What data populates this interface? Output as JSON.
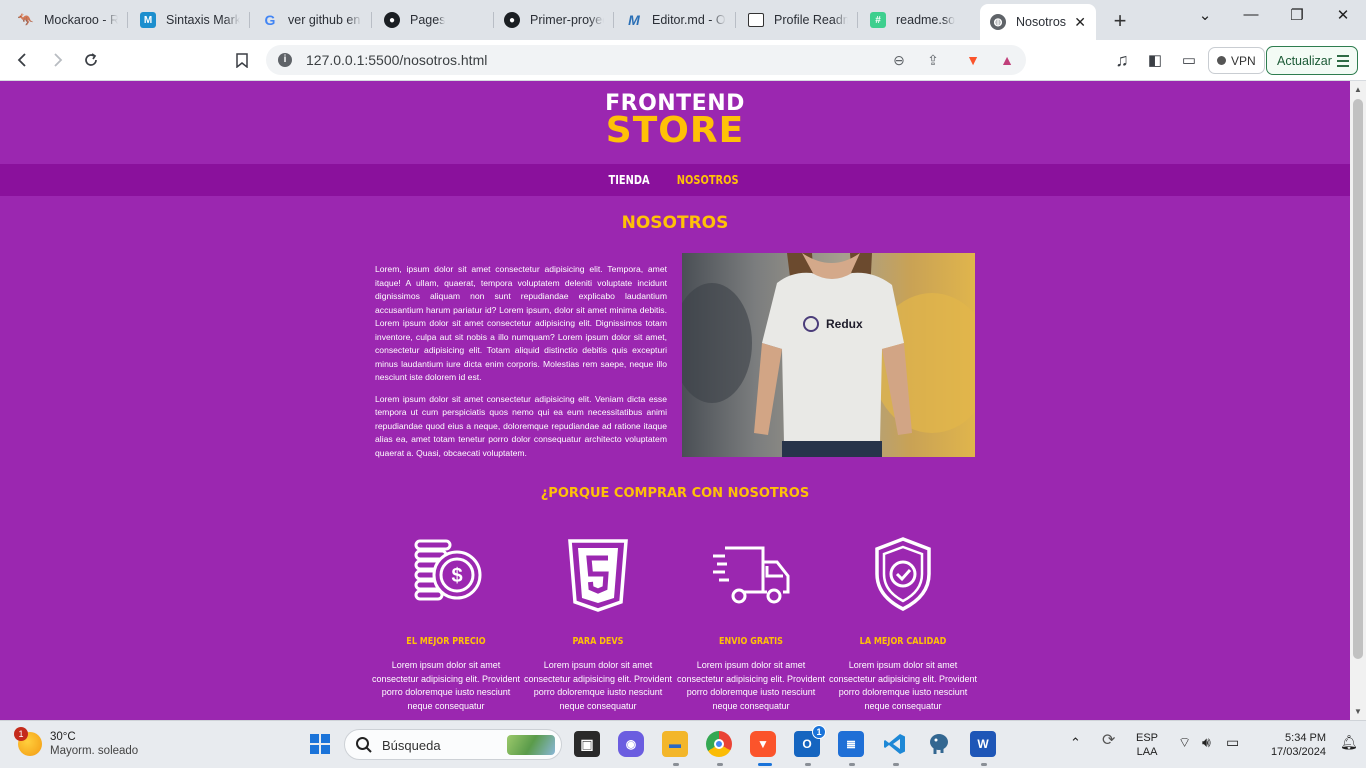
{
  "browser": {
    "tabs": [
      {
        "title": "Mockaroo - Ra",
        "icon": "mockaroo-icon"
      },
      {
        "title": "Sintaxis Markd",
        "icon": "markdown-icon"
      },
      {
        "title": "ver github en c",
        "icon": "google-icon"
      },
      {
        "title": "Pages",
        "icon": "github-icon"
      },
      {
        "title": "Primer-proyec",
        "icon": "github-icon"
      },
      {
        "title": "Editor.md - Op",
        "icon": "editormd-icon"
      },
      {
        "title": "Profile Readm",
        "icon": "document-icon"
      },
      {
        "title": "readme.so",
        "icon": "readme-icon"
      },
      {
        "title": "Nosotros",
        "icon": "globe-icon",
        "active": true
      }
    ],
    "url": "127.0.0.1:5500/nosotros.html",
    "vpn_label": "VPN",
    "update_label": "Actualizar"
  },
  "page": {
    "logo_line1": "FRONTEND",
    "logo_line2": "STORE",
    "nav": {
      "shop": "TIENDA",
      "about": "NOSOTROS"
    },
    "about_title": "NOSOTROS",
    "about_paragraphs": [
      "Lorem, ipsum dolor sit amet consectetur adipisicing elit. Tempora, amet itaque! A ullam, quaerat, tempora voluptatem deleniti voluptate incidunt dignissimos aliquam non sunt repudiandae explicabo laudantium accusantium harum pariatur id? Lorem ipsum, dolor sit amet minima debitis. Lorem ipsum dolor sit amet consectetur adipisicing elit. Dignissimos totam inventore, culpa aut sit nobis a illo numquam? Lorem ipsum dolor sit amet, consectetur adipisicing elit. Totam aliquid distinctio debitis quis excepturi minus laudantium iure dicta enim corporis. Molestias rem saepe, neque illo nesciunt iste dolorem id est.",
      "Lorem ipsum dolor sit amet consectetur adipisicing elit. Veniam dicta esse tempora ut cum perspiciatis quos nemo qui ea eum necessitatibus animi repudiandae quod eius a neque, doloremque repudiandae ad ratione itaque alias ea, amet totam tenetur porro dolor consequatur architecto voluptatem quaerat a. Quasi, obcaecati voluptatem."
    ],
    "shirt_brand": "Redux",
    "why_title": "¿PORQUE COMPRAR CON NOSOTROS",
    "features": [
      {
        "title": "EL MEJOR PRECIO",
        "icon": "coins-dollar-icon",
        "text": "Lorem ipsum dolor sit amet consectetur adipisicing elit. Provident porro doloremque iusto nesciunt neque consequatur"
      },
      {
        "title": "PARA DEVS",
        "icon": "html5-icon",
        "text": "Lorem ipsum dolor sit amet consectetur adipisicing elit. Provident porro doloremque iusto nesciunt neque consequatur"
      },
      {
        "title": "ENVIO GRATIS",
        "icon": "delivery-truck-icon",
        "text": "Lorem ipsum dolor sit amet consectetur adipisicing elit. Provident porro doloremque iusto nesciunt neque consequatur"
      },
      {
        "title": "LA MEJOR CALIDAD",
        "icon": "shield-check-icon",
        "text": "Lorem ipsum dolor sit amet consectetur adipisicing elit. Provident porro doloremque iusto nesciunt neque consequatur"
      }
    ]
  },
  "taskbar": {
    "weather_temp": "30°C",
    "weather_desc": "Mayorm. soleado",
    "weather_badge": "1",
    "search_label": "Búsqueda",
    "outlook_badge": "1",
    "lang1": "ESP",
    "lang2": "LAA",
    "time": "5:34 PM",
    "date": "17/03/2024"
  },
  "colors": {
    "page_bg": "#9b27b0",
    "nav_bg": "#8a119c",
    "accent": "#ffc107"
  }
}
